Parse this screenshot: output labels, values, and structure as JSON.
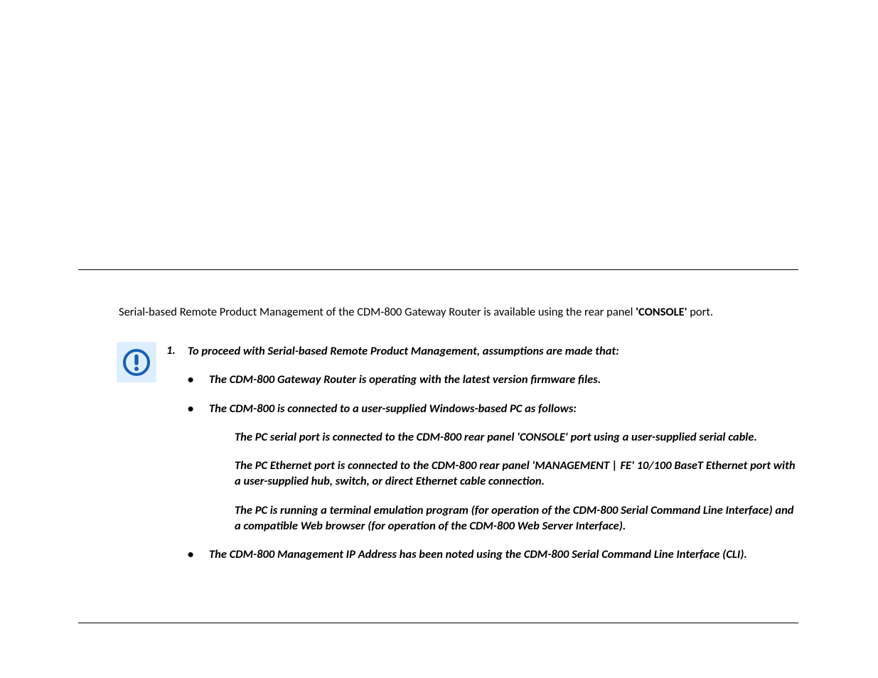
{
  "intro": {
    "before": "Serial-based Remote Product Management of the CDM-800 Gateway Router is available using the rear panel ",
    "bold": "'CONSOLE'",
    "after": " port."
  },
  "note": {
    "number": "1.",
    "lead": "To proceed with Serial-based Remote Product Management, assumptions are made that:",
    "bullets": {
      "b1": "The CDM-800 Gateway Router is operating with the latest version firmware files.",
      "b2": "The CDM-800 is connected to a user-supplied Windows-based PC as follows:",
      "b3": "The CDM-800 Management IP Address has been noted using the CDM-800 Serial Command Line Interface (CLI)."
    },
    "sub": {
      "s1": "The PC serial port is connected to the CDM-800 rear panel 'CONSOLE' port using a user-supplied serial cable.",
      "s2": "The PC Ethernet port is connected to the CDM-800 rear panel 'MANAGEMENT | FE' 10/100 BaseT Ethernet port with a user-supplied hub, switch, or direct Ethernet cable connection.",
      "s3": "The PC is running a terminal emulation program (for operation of the CDM-800 Serial Command Line Interface) and a compatible Web browser (for operation of the CDM-800 Web Server Interface)."
    }
  }
}
